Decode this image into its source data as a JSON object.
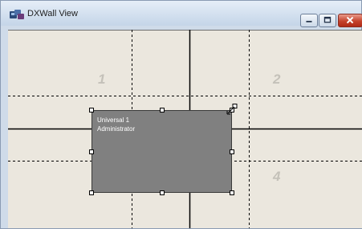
{
  "window": {
    "title": "DXWall View",
    "app_icon": "dxwall-app-icon",
    "controls": [
      {
        "name": "minimize-button",
        "icon": "minimize-icon"
      },
      {
        "name": "maximize-button",
        "icon": "maximize-icon"
      },
      {
        "name": "close-button",
        "icon": "close-icon"
      }
    ]
  },
  "wall": {
    "cells": [
      "1",
      "2",
      "4"
    ]
  },
  "source_window": {
    "title": "Universal   1",
    "user": "Administrator",
    "resize_icon": "resize-diagonal-icon"
  },
  "colors": {
    "canvas_background": "#ebe7de",
    "panel_fill": "#808080",
    "cell_number": "#c4c1b9"
  }
}
